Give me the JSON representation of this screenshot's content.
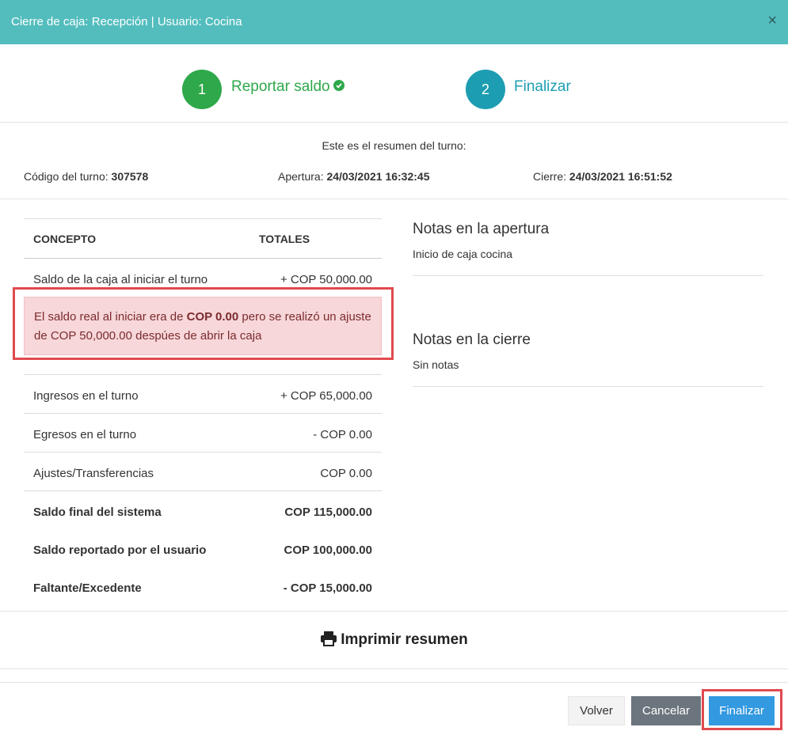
{
  "header": {
    "title": "Cierre de caja: Recepción | Usuario: Cocina",
    "close_glyph": "×"
  },
  "steps": [
    {
      "number": "1",
      "label": "Reportar saldo",
      "color": "#2ea84a"
    },
    {
      "number": "2",
      "label": "Finalizar",
      "color": "#1d9db2"
    }
  ],
  "summary": {
    "intro": "Este es el resumen del turno:",
    "code_label": "Código del turno:",
    "code_value": "307578",
    "open_label": "Apertura:",
    "open_value": "24/03/2021 16:32:45",
    "close_label": "Cierre:",
    "close_value": "24/03/2021 16:51:52"
  },
  "table": {
    "col_concept": "CONCEPTO",
    "col_totals": "TOTALES",
    "rows": [
      {
        "label": "Saldo de la caja al iniciar el turno",
        "value": "+ COP 50,000.00"
      },
      {
        "label": "Ingresos en el turno",
        "value": "+ COP 65,000.00"
      },
      {
        "label": "Egresos en el turno",
        "value": "- COP 0.00"
      },
      {
        "label": "Ajustes/Transferencias",
        "value": "COP 0.00"
      }
    ],
    "totals": [
      {
        "label": "Saldo final del sistema",
        "value": "COP 115,000.00"
      },
      {
        "label": "Saldo reportado por el usuario",
        "value": "COP 100,000.00"
      },
      {
        "label": "Faltante/Excedente",
        "value": "- COP 15,000.00"
      }
    ]
  },
  "alert": {
    "part1": "El saldo real al iniciar era de ",
    "bold": "COP 0.00",
    "part2": " pero se realizó un ajuste de COP 50,000.00 despúes de abrir la caja"
  },
  "notes": {
    "open_title": "Notas en la apertura",
    "open_text": "Inicio de caja cocina",
    "close_title": "Notas en la cierre",
    "close_text": "Sin notas"
  },
  "print_label": "Imprimir resumen",
  "buttons": {
    "back": "Volver",
    "cancel": "Cancelar",
    "finish": "Finalizar"
  },
  "colors": {
    "header": "#53bdbe",
    "alert_bg": "#f7d7d9",
    "highlight": "#e04a4f",
    "primary": "#3399e0"
  }
}
